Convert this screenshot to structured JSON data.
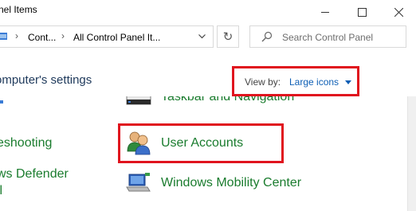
{
  "window": {
    "title": "nel Items",
    "minimize_icon": "minimize-icon",
    "maximize_icon": "maximize-icon",
    "close_icon": "close-icon"
  },
  "address": {
    "crumbs": [
      "Cont...",
      "All Control Panel It..."
    ],
    "separator": "›"
  },
  "search": {
    "placeholder": "Search Control Panel"
  },
  "header": {
    "heading": "omputer's settings",
    "view_by_label": "View by:",
    "view_by_value": "Large icons"
  },
  "items_left": [
    {
      "label": "eshooting"
    },
    {
      "label": "ws Defender"
    },
    {
      "label": "ll"
    }
  ],
  "items_right": [
    {
      "label": "Taskbar and Navigation",
      "icon": "taskbar-icon"
    },
    {
      "label": "User Accounts",
      "icon": "user-accounts-icon"
    },
    {
      "label": "Windows Mobility Center",
      "icon": "mobility-center-icon"
    }
  ],
  "colors": {
    "highlight": "#e0141e",
    "link_green": "#1a7c2e",
    "link_blue": "#0e5fb5"
  }
}
